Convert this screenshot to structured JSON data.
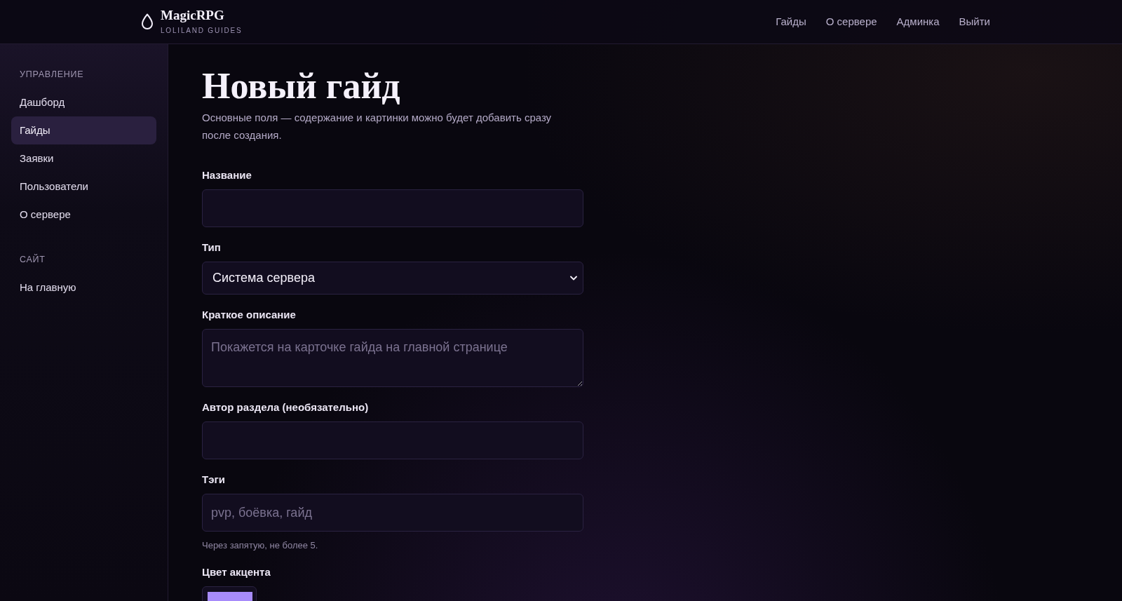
{
  "header": {
    "logo_title": "MagicRPG",
    "logo_subtitle": "LOLILAND GUIDES",
    "nav": [
      {
        "label": "Гайды"
      },
      {
        "label": "О сервере"
      },
      {
        "label": "Админка"
      },
      {
        "label": "Выйти"
      }
    ]
  },
  "sidebar": {
    "sections": [
      {
        "title": "УПРАВЛЕНИЕ",
        "items": [
          {
            "label": "Дашборд",
            "selected": false
          },
          {
            "label": "Гайды",
            "selected": true
          },
          {
            "label": "Заявки",
            "selected": false
          },
          {
            "label": "Пользователи",
            "selected": false
          },
          {
            "label": "О сервере",
            "selected": false
          }
        ]
      },
      {
        "title": "САЙТ",
        "items": [
          {
            "label": "На главную",
            "selected": false
          }
        ]
      }
    ]
  },
  "main": {
    "title": "Новый гайд",
    "description": "Основные поля — содержание и картинки можно будет добавить сразу после создания.",
    "fields": [
      {
        "kind": "input",
        "label": "Название"
      },
      {
        "kind": "select",
        "label": "Тип",
        "value": "Система сервера"
      },
      {
        "kind": "textarea",
        "label": "Краткое описание",
        "placeholder": "Покажется на карточке гайда на главной странице"
      },
      {
        "kind": "input",
        "label": "Автор раздела (необязательно)"
      },
      {
        "kind": "input",
        "label": "Тэги",
        "placeholder": "pvp, боёвка, гайд",
        "hint": "Через запятую, не более 5."
      },
      {
        "kind": "color",
        "label": "Цвет акцента",
        "color": "#a78bfa"
      }
    ]
  }
}
